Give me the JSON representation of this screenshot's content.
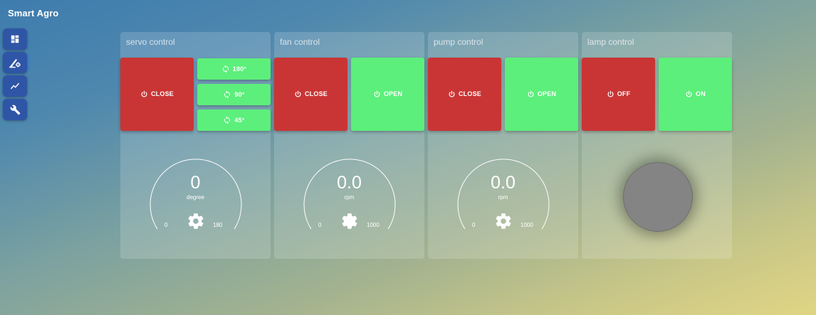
{
  "app": {
    "title": "Smart Agro"
  },
  "sidebar": {
    "items": [
      {
        "icon": "dashboard-icon",
        "active": false
      },
      {
        "icon": "control-icon",
        "active": true
      },
      {
        "icon": "chart-icon",
        "active": false
      },
      {
        "icon": "wrench-icon",
        "active": false
      }
    ]
  },
  "colors": {
    "off_button": "#c93535",
    "on_button": "#5cef7b",
    "nav_button": "#2f55a6",
    "lamp_off": "#848484"
  },
  "panels": {
    "servo": {
      "title": "servo control",
      "close_label": "CLOSE",
      "presets": [
        "180°",
        "90°",
        "45°"
      ],
      "gauge": {
        "value": "0",
        "unit": "degree",
        "min": "0",
        "max": "180",
        "level": 0
      }
    },
    "fan": {
      "title": "fan control",
      "close_label": "CLOSE",
      "open_label": "OPEN",
      "gauge": {
        "value": "0.0",
        "unit": "rpm",
        "min": "0",
        "max": "1000",
        "level": 0
      }
    },
    "pump": {
      "title": "pump control",
      "close_label": "CLOSE",
      "open_label": "OPEN",
      "gauge": {
        "value": "0.0",
        "unit": "rpm",
        "min": "0",
        "max": "1000",
        "level": 0
      }
    },
    "lamp": {
      "title": "lamp control",
      "off_label": "OFF",
      "on_label": "ON",
      "state": "off"
    }
  }
}
